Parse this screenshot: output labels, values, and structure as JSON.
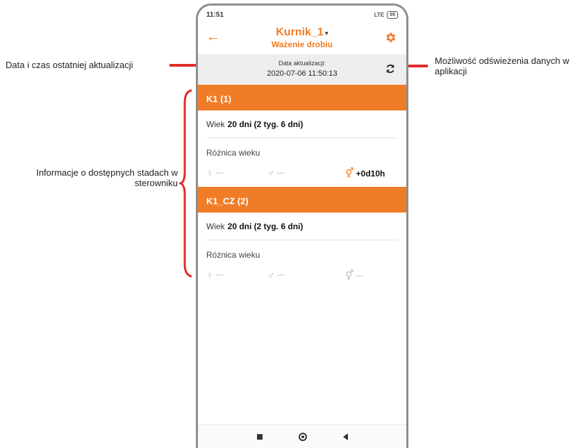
{
  "annotations": {
    "last_update": "Data i czas ostatniej aktualizacji",
    "refresh": "Możliwość odświeżenia danych w aplikacji",
    "flocks_info": "Informacje o dostępnych stadach w sterowniku"
  },
  "status_bar": {
    "time": "11:51",
    "signal": "LTE",
    "battery": "89"
  },
  "header": {
    "title": "Kurnik_1",
    "caret": "▾",
    "subtitle": "Ważenie drobiu"
  },
  "update": {
    "label": "Data aktualizacji:",
    "value": "2020-07-06 11:50:13"
  },
  "flocks": [
    {
      "name": "K1 (1)",
      "age_label": "Wiek",
      "age_value": "20 dni (2 tyg. 6 dni)",
      "diff_label": "Różnica wieku",
      "female": "---",
      "male": "---",
      "both": "+0d10h"
    },
    {
      "name": "K1_CZ (2)",
      "age_label": "Wiek",
      "age_value": "20 dni (2 tyg. 6 dni)",
      "diff_label": "Różnica wieku",
      "female": "---",
      "male": "---",
      "both": "---"
    }
  ],
  "colors": {
    "accent": "#f07c27",
    "annotation_arrow": "#e12b2b"
  },
  "icons": [
    "back-arrow-icon",
    "gear-icon",
    "refresh-icon",
    "female-icon",
    "male-icon",
    "male-female-icon"
  ]
}
